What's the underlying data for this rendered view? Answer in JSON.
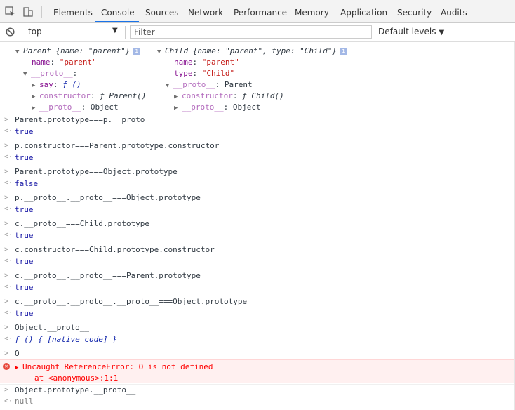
{
  "tabs": [
    "Elements",
    "Console",
    "Sources",
    "Network",
    "Performance",
    "Memory",
    "Application",
    "Security",
    "Audits"
  ],
  "active_tab": "Console",
  "filterbar": {
    "context": "top",
    "filter_placeholder": "Filter",
    "levels": "Default levels"
  },
  "objects": {
    "parent": {
      "summary_name": "Parent",
      "summary_body": "{name: \"parent\"}",
      "name_key": "name",
      "name_val": "\"parent\"",
      "proto_key": "__proto__",
      "say_key": "say",
      "say_val": "ƒ ()",
      "ctor_key": "constructor",
      "ctor_val": "ƒ Parent()",
      "proto2_key": "__proto__",
      "proto2_val": "Object"
    },
    "child": {
      "summary_name": "Child",
      "summary_body": "{name: \"parent\", type: \"Child\"}",
      "name_key": "name",
      "name_val": "\"parent\"",
      "type_key": "type",
      "type_val": "\"Child\"",
      "proto_key": "__proto__",
      "proto_val": "Parent",
      "ctor_key": "constructor",
      "ctor_val": "ƒ Child()",
      "proto2_key": "__proto__",
      "proto2_val": "Object"
    }
  },
  "entries": [
    {
      "input": "Parent.prototype===p.__proto__",
      "output": "true"
    },
    {
      "input": "p.constructor===Parent.prototype.constructor",
      "output": "true"
    },
    {
      "input": "Parent.prototype===Object.prototype",
      "output": "false"
    },
    {
      "input": "p.__proto__.__proto__===Object.prototype",
      "output": "true"
    },
    {
      "input": "c.__proto__===Child.prototype",
      "output": "true"
    },
    {
      "input": "c.constructor===Child.prototype.constructor",
      "output": "true"
    },
    {
      "input": "c.__proto__.__proto__===Parent.prototype",
      "output": "true"
    },
    {
      "input": "c.__proto__.__proto__.__proto__===Object.prototype",
      "output": "true"
    },
    {
      "input": "Object.__proto__",
      "output": "ƒ () { [native code] }"
    }
  ],
  "error_entry": {
    "input": "O",
    "message": "Uncaught ReferenceError: O is not defined",
    "trace": "at <anonymous>:1:1"
  },
  "last_entry": {
    "input": "Object.prototype.__proto__",
    "output": "null"
  }
}
